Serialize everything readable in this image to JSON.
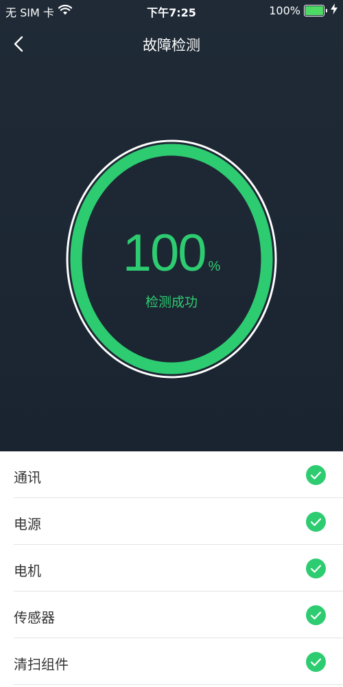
{
  "status_bar": {
    "carrier": "无 SIM 卡",
    "time": "下午7:25",
    "battery_percent": "100%"
  },
  "nav": {
    "title": "故障检测"
  },
  "gauge": {
    "value": "100",
    "unit": "%",
    "status": "检测成功",
    "progress": 1.0,
    "accent_color": "#2ecc71"
  },
  "checks": [
    {
      "label": "通讯",
      "status": "passed"
    },
    {
      "label": "电源",
      "status": "passed"
    },
    {
      "label": "电机",
      "status": "passed"
    },
    {
      "label": "传感器",
      "status": "passed"
    },
    {
      "label": "清扫组件",
      "status": "passed"
    }
  ],
  "colors": {
    "background_top": "#1f2a36",
    "success": "#2ecc71",
    "battery": "#4cd964"
  }
}
